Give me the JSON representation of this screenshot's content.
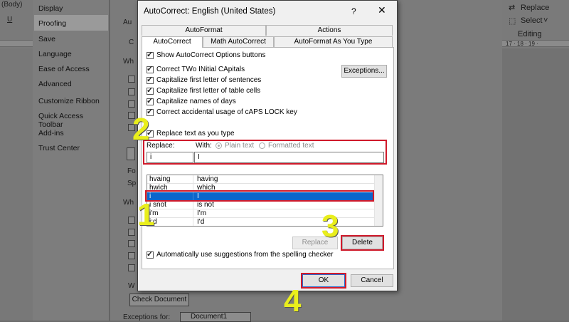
{
  "ribbon": {
    "left_top": "(Body)",
    "left_u": "U",
    "replace": "Replace",
    "select": "Select",
    "editing": "Editing",
    "ruler_right": "17 · 18 · 19 ·"
  },
  "options": {
    "nav": [
      "Display",
      "Proofing",
      "Save",
      "Language",
      "Ease of Access",
      "Advanced",
      "Customize Ribbon",
      "Quick Access Toolbar",
      "Add-ins",
      "Trust Center"
    ],
    "active_nav": "Proofing",
    "bg_texts": [
      "Au",
      "C",
      "Wh",
      "Fo",
      "Sp",
      "Wh",
      "W"
    ],
    "check_document": "Check Document",
    "exceptions_for": "Exceptions for:",
    "document_name": "Document1"
  },
  "dialog": {
    "title": "AutoCorrect: English (United States)",
    "help": "?",
    "close": "✕",
    "tabs_row1": [
      "AutoFormat",
      "Actions"
    ],
    "tabs_row2": [
      "AutoCorrect",
      "Math AutoCorrect",
      "AutoFormat As You Type"
    ],
    "show_buttons": "Show AutoCorrect Options buttons",
    "options": [
      "Correct TWo INitial CApitals",
      "Capitalize first letter of sentences",
      "Capitalize first letter of table cells",
      "Capitalize names of days",
      "Correct accidental usage of cAPS LOCK key"
    ],
    "exceptions_button": "Exceptions...",
    "replace_as_type": "Replace text as you type",
    "replace_label": "Replace:",
    "with_label": "With:",
    "plain_text": "Plain text",
    "formatted_text": "Formatted text",
    "replace_value": "i",
    "with_value": "I",
    "entries": [
      {
        "from": "hvaing",
        "to": "having"
      },
      {
        "from": "hwich",
        "to": "which"
      },
      {
        "from": "i",
        "to": "I"
      },
      {
        "from": "i snot",
        "to": "is not"
      },
      {
        "from": "i'm",
        "to": "I'm"
      },
      {
        "from": "i;d",
        "to": "I'd"
      }
    ],
    "replace_button": "Replace",
    "delete_button": "Delete",
    "auto_suggest": "Automatically use suggestions from the spelling checker",
    "ok": "OK",
    "cancel": "Cancel"
  },
  "annotations": {
    "steps": [
      "1",
      "2",
      "3",
      "4"
    ],
    "highlight_color": "#d01a2b",
    "number_color": "#e9ee1c"
  }
}
